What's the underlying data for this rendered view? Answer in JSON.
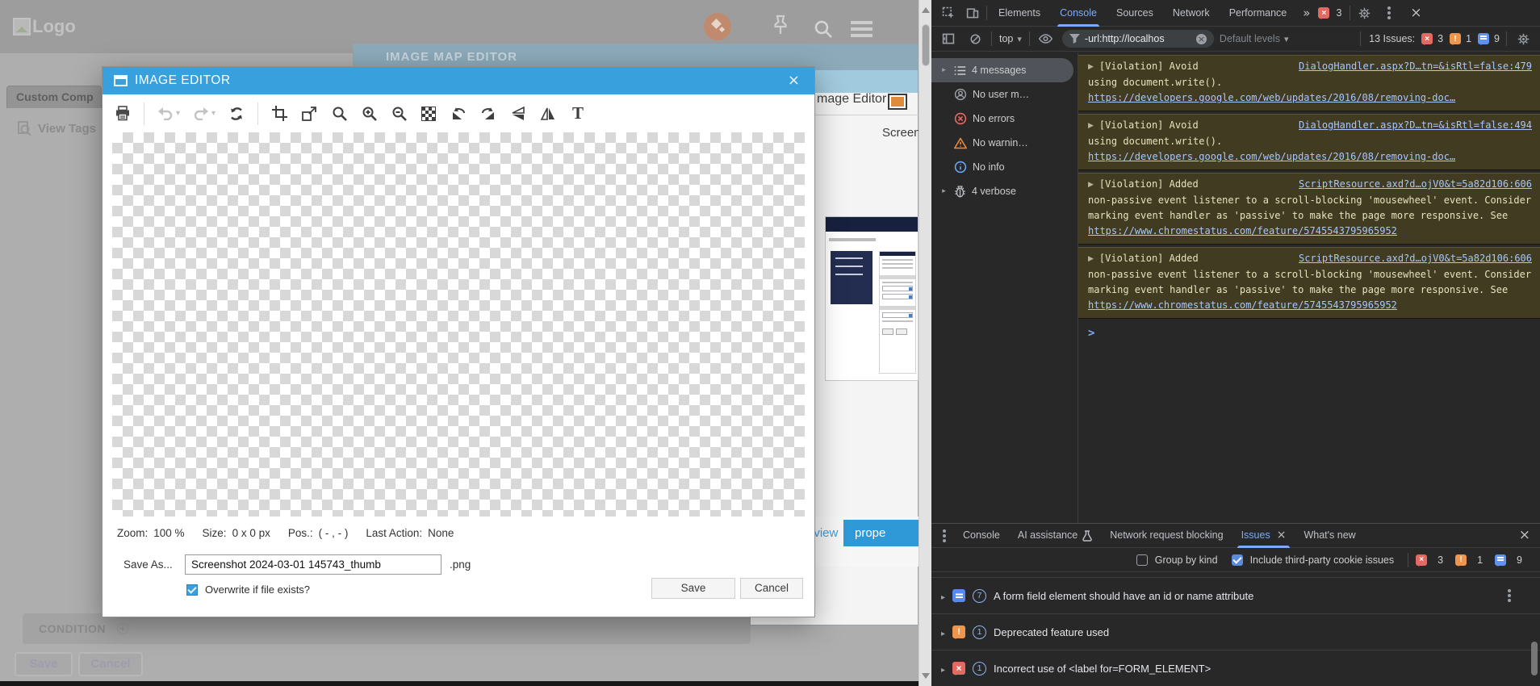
{
  "colors": {
    "dialog_accent": "#38a0dc",
    "devtools_accent": "#7cacf8",
    "violation_bg": "#413b22",
    "error": "#e46962",
    "warning": "#f0954c",
    "info": "#568af2"
  },
  "page": {
    "logo": "Logo",
    "custom_components_tab": "Custom Comp",
    "view_tags": "View Tags",
    "behind_dialog_title": "IMAGE MAP EDITOR",
    "image_editor_tab": "mage Editor",
    "screenshot_label": "Screen",
    "preview_tab": "eview",
    "properties_tab": "prope",
    "condition_label": "CONDITION",
    "save_button": "Save",
    "cancel_button": "Cancel"
  },
  "dialog": {
    "title": "IMAGE EDITOR",
    "close": "×",
    "status": {
      "zoom_label": "Zoom:",
      "zoom_value": "100 %",
      "size_label": "Size:",
      "size_value": "0 x 0 px",
      "pos_label": "Pos.:",
      "pos_value": "( - , - )",
      "last_action_label": "Last Action:",
      "last_action_value": "None"
    },
    "save_as_label": "Save As...",
    "filename": "Screenshot 2024-03-01 145743_thumb",
    "extension": ".png",
    "overwrite_label": "Overwrite if file exists?",
    "save_button": "Save",
    "cancel_button": "Cancel"
  },
  "devtools": {
    "tabs": {
      "elements": "Elements",
      "console": "Console",
      "sources": "Sources",
      "network": "Network",
      "performance": "Performance",
      "more": "»",
      "error_count": "3"
    },
    "toolbar": {
      "context": "top",
      "filter_value": "-url:http://localhos",
      "levels": "Default levels",
      "issues_label": "13 Issues:",
      "errors": "3",
      "warnings": "1",
      "infos": "9"
    },
    "sidebar": {
      "items": [
        {
          "label": "4 messages"
        },
        {
          "label": "No user m…"
        },
        {
          "label": "No errors"
        },
        {
          "label": "No warnin…"
        },
        {
          "label": "No info"
        },
        {
          "label": "4 verbose"
        }
      ]
    },
    "messages": [
      {
        "prefix": "[Violation] Avoid",
        "body": "using document.write().",
        "source": "DialogHandler.aspx?D…tn=&isRtl=false:479",
        "url": "https://developers.google.com/web/updates/2016/08/removing-doc…"
      },
      {
        "prefix": "[Violation] Avoid",
        "body": "using document.write().",
        "source": "DialogHandler.aspx?D…tn=&isRtl=false:494",
        "url": "https://developers.google.com/web/updates/2016/08/removing-doc…"
      },
      {
        "prefix": "[Violation] Added",
        "body": "non-passive event listener to a scroll-blocking 'mousewheel' event. Consider marking event handler as 'passive' to make the page more responsive. See",
        "source": "ScriptResource.axd?d…ojV0&t=5a82d106:606",
        "url": "https://www.chromestatus.com/feature/5745543795965952"
      },
      {
        "prefix": "[Violation] Added",
        "body": "non-passive event listener to a scroll-blocking 'mousewheel' event. Consider marking event handler as 'passive' to make the page more responsive. See",
        "source": "ScriptResource.axd?d…ojV0&t=5a82d106:606",
        "url": "https://www.chromestatus.com/feature/5745543795965952"
      }
    ],
    "prompt": ">",
    "drawer": {
      "tabs": [
        "Console",
        "AI assistance",
        "Network request blocking",
        "Issues",
        "What's new"
      ],
      "active_tab": "Issues",
      "close": "×"
    },
    "issues_toolbar": {
      "group_by_kind": "Group by kind",
      "include_third_party": "Include third-party cookie issues",
      "errors": "3",
      "warnings": "1",
      "infos": "9"
    },
    "issues": [
      {
        "count": "7",
        "title": "A form field element should have an id or name attribute",
        "kind": "info"
      },
      {
        "count": "1",
        "title": "Deprecated feature used",
        "kind": "warning"
      },
      {
        "count": "1",
        "title": "Incorrect use of <label for=FORM_ELEMENT>",
        "kind": "error"
      }
    ]
  }
}
